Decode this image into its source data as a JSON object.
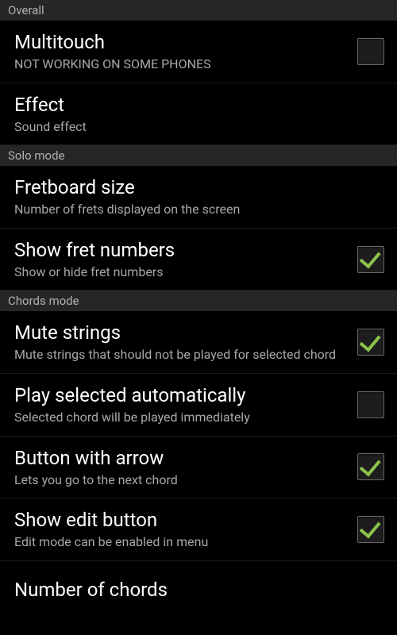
{
  "sections": {
    "overall": {
      "header": "Overall",
      "items": [
        {
          "title": "Multitouch",
          "subtitle": "NOT WORKING ON SOME PHONES",
          "checkbox": true,
          "checked": false
        },
        {
          "title": "Effect",
          "subtitle": "Sound effect",
          "checkbox": false
        }
      ]
    },
    "solo": {
      "header": "Solo mode",
      "items": [
        {
          "title": "Fretboard size",
          "subtitle": "Number of frets displayed on the screen",
          "checkbox": false
        },
        {
          "title": "Show fret numbers",
          "subtitle": "Show or hide fret numbers",
          "checkbox": true,
          "checked": true
        }
      ]
    },
    "chords": {
      "header": "Chords mode",
      "items": [
        {
          "title": "Mute strings",
          "subtitle": "Mute strings that should not be played for selected chord",
          "checkbox": true,
          "checked": true
        },
        {
          "title": "Play selected automatically",
          "subtitle": "Selected chord will be played immediately",
          "checkbox": true,
          "checked": false
        },
        {
          "title": "Button with arrow",
          "subtitle": "Lets you go to the next chord",
          "checkbox": true,
          "checked": true
        },
        {
          "title": "Show edit button",
          "subtitle": "Edit mode can be enabled in menu",
          "checkbox": true,
          "checked": true
        },
        {
          "title": "Number of chords",
          "subtitle": "",
          "checkbox": false
        }
      ]
    }
  }
}
